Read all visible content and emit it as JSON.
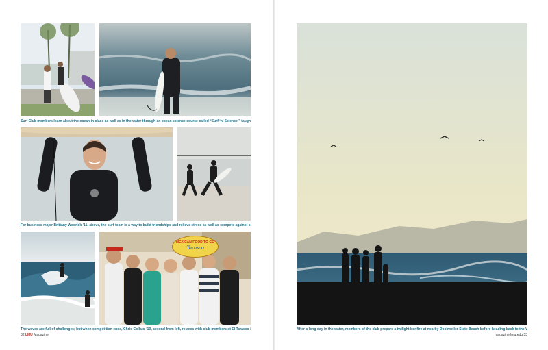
{
  "left_page": {
    "captions": {
      "surf_science": "Surf Club members learn about the ocean in class as well as in the water through an ocean science course called “Surf ‘n’ Science,” taught by Professor John Dorsey.",
      "wodrick": "For business major Brittany Wodrick ’11, above, the surf team is a way to build friendships and relieve stress as well as compete against surfers from rival schools.",
      "challenges": "The waves are full of challenges; but when competition ends, Chris Collato ’10, second from left, relaxes with club members at El Tarasco in Manhattan Beach."
    },
    "sign_text": "MEXICAN FOOD TO GO",
    "sign_script": "Tarasco",
    "folio": {
      "page_number": "32",
      "brand": "LMU",
      "magazine": "Magazine"
    }
  },
  "right_page": {
    "caption": "After a long day in the water, members of the club prepare a twilight bonfire at nearby Dockweiler State Beach before heading back to the Westchester campus.",
    "folio": {
      "url": "magazine.lmu.edu",
      "page_number": "33"
    }
  },
  "colors": {
    "caption_blue": "#1f6f8b",
    "brand_red": "#c6281c",
    "sky_twilight": "#e9e6c8",
    "ocean_blue": "#2f5a74"
  }
}
